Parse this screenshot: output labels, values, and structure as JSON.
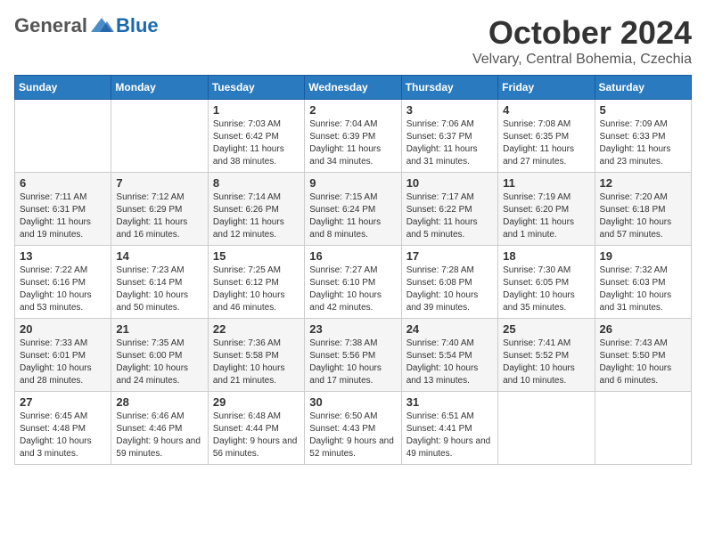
{
  "logo": {
    "general": "General",
    "blue": "Blue"
  },
  "header": {
    "month": "October 2024",
    "location": "Velvary, Central Bohemia, Czechia"
  },
  "weekdays": [
    "Sunday",
    "Monday",
    "Tuesday",
    "Wednesday",
    "Thursday",
    "Friday",
    "Saturday"
  ],
  "weeks": [
    [
      {
        "day": "",
        "info": ""
      },
      {
        "day": "",
        "info": ""
      },
      {
        "day": "1",
        "info": "Sunrise: 7:03 AM\nSunset: 6:42 PM\nDaylight: 11 hours and 38 minutes."
      },
      {
        "day": "2",
        "info": "Sunrise: 7:04 AM\nSunset: 6:39 PM\nDaylight: 11 hours and 34 minutes."
      },
      {
        "day": "3",
        "info": "Sunrise: 7:06 AM\nSunset: 6:37 PM\nDaylight: 11 hours and 31 minutes."
      },
      {
        "day": "4",
        "info": "Sunrise: 7:08 AM\nSunset: 6:35 PM\nDaylight: 11 hours and 27 minutes."
      },
      {
        "day": "5",
        "info": "Sunrise: 7:09 AM\nSunset: 6:33 PM\nDaylight: 11 hours and 23 minutes."
      }
    ],
    [
      {
        "day": "6",
        "info": "Sunrise: 7:11 AM\nSunset: 6:31 PM\nDaylight: 11 hours and 19 minutes."
      },
      {
        "day": "7",
        "info": "Sunrise: 7:12 AM\nSunset: 6:29 PM\nDaylight: 11 hours and 16 minutes."
      },
      {
        "day": "8",
        "info": "Sunrise: 7:14 AM\nSunset: 6:26 PM\nDaylight: 11 hours and 12 minutes."
      },
      {
        "day": "9",
        "info": "Sunrise: 7:15 AM\nSunset: 6:24 PM\nDaylight: 11 hours and 8 minutes."
      },
      {
        "day": "10",
        "info": "Sunrise: 7:17 AM\nSunset: 6:22 PM\nDaylight: 11 hours and 5 minutes."
      },
      {
        "day": "11",
        "info": "Sunrise: 7:19 AM\nSunset: 6:20 PM\nDaylight: 11 hours and 1 minute."
      },
      {
        "day": "12",
        "info": "Sunrise: 7:20 AM\nSunset: 6:18 PM\nDaylight: 10 hours and 57 minutes."
      }
    ],
    [
      {
        "day": "13",
        "info": "Sunrise: 7:22 AM\nSunset: 6:16 PM\nDaylight: 10 hours and 53 minutes."
      },
      {
        "day": "14",
        "info": "Sunrise: 7:23 AM\nSunset: 6:14 PM\nDaylight: 10 hours and 50 minutes."
      },
      {
        "day": "15",
        "info": "Sunrise: 7:25 AM\nSunset: 6:12 PM\nDaylight: 10 hours and 46 minutes."
      },
      {
        "day": "16",
        "info": "Sunrise: 7:27 AM\nSunset: 6:10 PM\nDaylight: 10 hours and 42 minutes."
      },
      {
        "day": "17",
        "info": "Sunrise: 7:28 AM\nSunset: 6:08 PM\nDaylight: 10 hours and 39 minutes."
      },
      {
        "day": "18",
        "info": "Sunrise: 7:30 AM\nSunset: 6:05 PM\nDaylight: 10 hours and 35 minutes."
      },
      {
        "day": "19",
        "info": "Sunrise: 7:32 AM\nSunset: 6:03 PM\nDaylight: 10 hours and 31 minutes."
      }
    ],
    [
      {
        "day": "20",
        "info": "Sunrise: 7:33 AM\nSunset: 6:01 PM\nDaylight: 10 hours and 28 minutes."
      },
      {
        "day": "21",
        "info": "Sunrise: 7:35 AM\nSunset: 6:00 PM\nDaylight: 10 hours and 24 minutes."
      },
      {
        "day": "22",
        "info": "Sunrise: 7:36 AM\nSunset: 5:58 PM\nDaylight: 10 hours and 21 minutes."
      },
      {
        "day": "23",
        "info": "Sunrise: 7:38 AM\nSunset: 5:56 PM\nDaylight: 10 hours and 17 minutes."
      },
      {
        "day": "24",
        "info": "Sunrise: 7:40 AM\nSunset: 5:54 PM\nDaylight: 10 hours and 13 minutes."
      },
      {
        "day": "25",
        "info": "Sunrise: 7:41 AM\nSunset: 5:52 PM\nDaylight: 10 hours and 10 minutes."
      },
      {
        "day": "26",
        "info": "Sunrise: 7:43 AM\nSunset: 5:50 PM\nDaylight: 10 hours and 6 minutes."
      }
    ],
    [
      {
        "day": "27",
        "info": "Sunrise: 6:45 AM\nSunset: 4:48 PM\nDaylight: 10 hours and 3 minutes."
      },
      {
        "day": "28",
        "info": "Sunrise: 6:46 AM\nSunset: 4:46 PM\nDaylight: 9 hours and 59 minutes."
      },
      {
        "day": "29",
        "info": "Sunrise: 6:48 AM\nSunset: 4:44 PM\nDaylight: 9 hours and 56 minutes."
      },
      {
        "day": "30",
        "info": "Sunrise: 6:50 AM\nSunset: 4:43 PM\nDaylight: 9 hours and 52 minutes."
      },
      {
        "day": "31",
        "info": "Sunrise: 6:51 AM\nSunset: 4:41 PM\nDaylight: 9 hours and 49 minutes."
      },
      {
        "day": "",
        "info": ""
      },
      {
        "day": "",
        "info": ""
      }
    ]
  ]
}
